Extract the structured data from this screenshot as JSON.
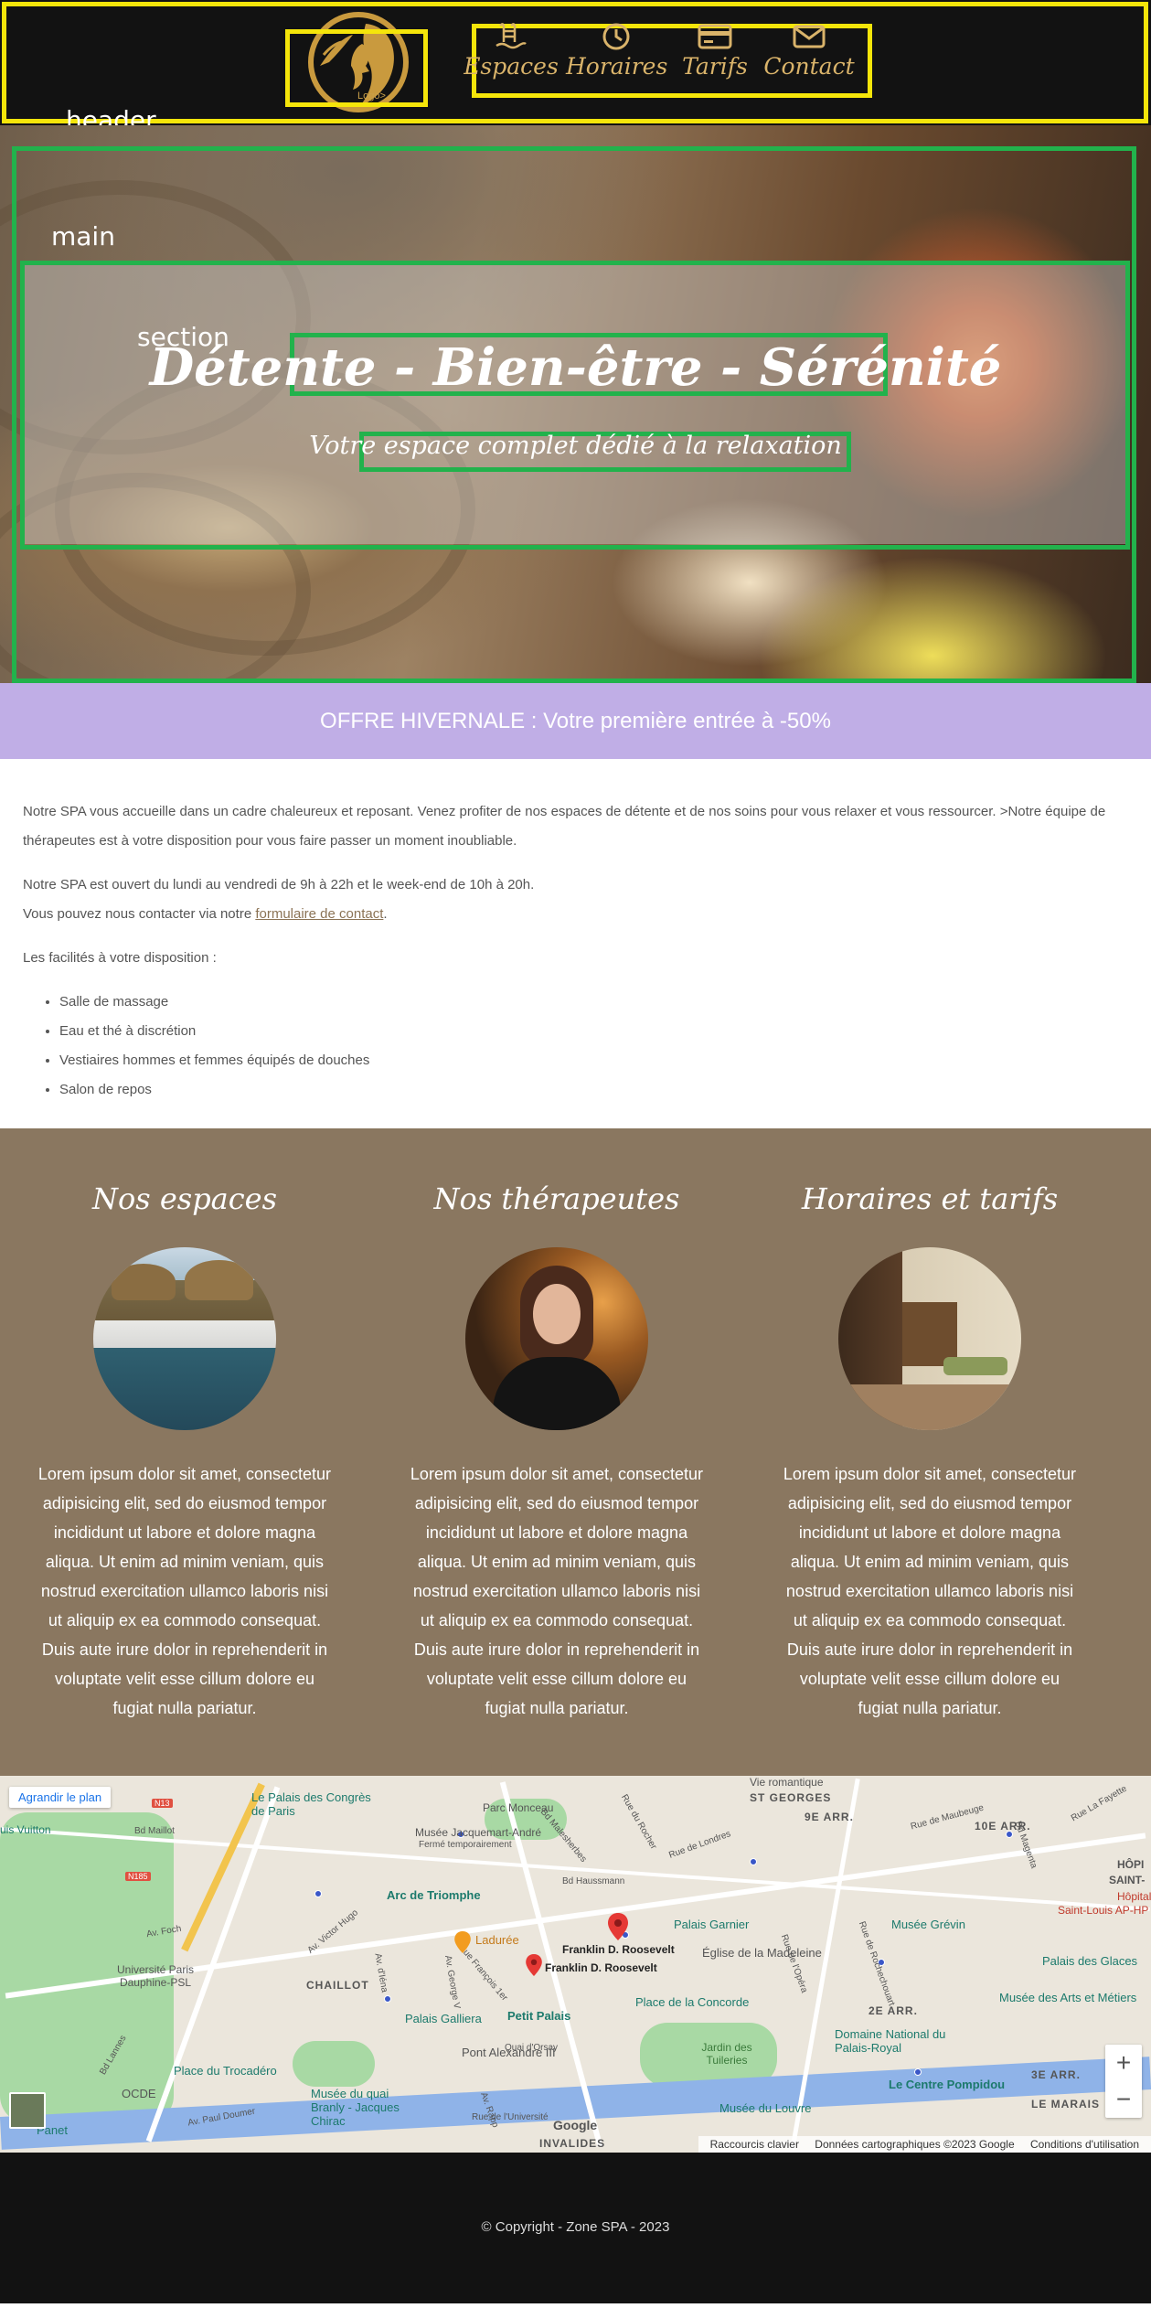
{
  "debug_labels": {
    "header": "header",
    "main": "main",
    "section": "section"
  },
  "header": {
    "logo_alt": "Logo>",
    "nav": [
      {
        "label": "Espaces",
        "icon": "pool-icon"
      },
      {
        "label": "Horaires",
        "icon": "clock-icon"
      },
      {
        "label": "Tarifs",
        "icon": "credit-card-icon"
      },
      {
        "label": "Contact",
        "icon": "envelope-icon"
      }
    ]
  },
  "hero": {
    "title": "Détente - Bien-être - Sérénité",
    "subtitle": "Votre espace complet dédié à la relaxation"
  },
  "offer": {
    "text": "OFFRE HIVERNALE : Votre première entrée à -50%"
  },
  "intro": {
    "p1": "Notre SPA vous accueille dans un cadre chaleureux et reposant. Venez profiter de nos espaces de détente et de nos soins pour vous relaxer et vous ressourcer. >Notre équipe de thérapeutes est à votre disposition pour vous faire passer un moment inoubliable.",
    "hours": "Notre SPA est ouvert du lundi au vendredi de 9h à 22h et le week-end de 10h à 20h.",
    "contact_prefix": "Vous pouvez nous contacter via notre ",
    "contact_link": "formulaire de contact",
    "contact_suffix": ".",
    "facilities_title": "Les facilités à votre disposition :",
    "facilities": [
      "Salle de massage",
      "Eau et thé à discrétion",
      "Vestiaires hommes et femmes équipés de douches",
      "Salon de repos"
    ]
  },
  "features": [
    {
      "title": "Nos espaces",
      "text": "Lorem ipsum dolor sit amet, consectetur adipisicing elit, sed do eiusmod tempor incididunt ut labore et dolore magna aliqua. Ut enim ad minim veniam, quis nostrud exercitation ullamco laboris nisi ut aliquip ex ea commodo consequat. Duis aute irure dolor in reprehenderit in voluptate velit esse cillum dolore eu fugiat nulla pariatur."
    },
    {
      "title": "Nos thérapeutes",
      "text": "Lorem ipsum dolor sit amet, consectetur adipisicing elit, sed do eiusmod tempor incididunt ut labore et dolore magna aliqua. Ut enim ad minim veniam, quis nostrud exercitation ullamco laboris nisi ut aliquip ex ea commodo consequat. Duis aute irure dolor in reprehenderit in voluptate velit esse cillum dolore eu fugiat nulla pariatur."
    },
    {
      "title": "Horaires et tarifs",
      "text": "Lorem ipsum dolor sit amet, consectetur adipisicing elit, sed do eiusmod tempor incididunt ut labore et dolore magna aliqua. Ut enim ad minim veniam, quis nostrud exercitation ullamco laboris nisi ut aliquip ex ea commodo consequat. Duis aute irure dolor in reprehenderit in voluptate velit esse cillum dolore eu fugiat nulla pariatur."
    }
  ],
  "map": {
    "enlarge": "Agrandir le plan",
    "labels": [
      "ST GEORGES",
      "9E ARR.",
      "10E ARR.",
      "CHAILLOT",
      "2E ARR.",
      "3E ARR.",
      "LE MARAIS",
      "INVALIDES",
      "Parc Monceau",
      "Bd Haussmann",
      "Bd Malesherbes",
      "Rue de Londres",
      "Av. Foch",
      "Av. Victor Hugo",
      "Bd Lannes",
      "Quai d'Orsay",
      "Rue de l'Université",
      "Av. Paul Doumer",
      "Musée Jacquemart-André",
      "Fermé temporairement",
      "Université Paris Dauphine-PSL",
      "Franklin D. Roosevelt",
      "Franklin D. Roosevelt",
      "Jardin des Tuileries",
      "Saint-Louis AP-HP",
      "Hôpital",
      "SAINT-",
      "HÔPI",
      "uis Vuitton",
      "Rue de Maubeuge",
      "Rue La Fayette",
      "Bd Magenta",
      "Rue du Rocher",
      "Rue de Rochechouart",
      "Vie romantique",
      "N13",
      "N185",
      "Av. George V",
      "Rue François 1er",
      "Av. d'Iéna",
      "Av. Rapp",
      "Rue de l'Opéra",
      "Bd Maillot"
    ],
    "pois": [
      "Le Palais des Congrès de Paris",
      "Arc de Triomphe",
      "Ladurée",
      "Palais Garnier",
      "Musée Grévin",
      "Église de la Madeleine",
      "Place de la Concorde",
      "Palais Galliera",
      "Petit Palais",
      "Pont Alexandre III",
      "Place du Trocadéro",
      "Musée du quai Branly - Jacques Chirac",
      "Domaine National du Palais-Royal",
      "Le Centre Pompidou",
      "Musée du Louvre",
      "Musée des Arts et Métiers",
      "Palais des Glaces",
      "OCDE",
      "Panet"
    ],
    "footer": [
      "Raccourcis clavier",
      "Données cartographiques ©2023 Google",
      "Conditions d'utilisation"
    ],
    "google": "Google",
    "zoom_in": "+",
    "zoom_out": "−"
  },
  "footer": {
    "copyright": "© Copyright - Zone SPA - 2023"
  },
  "colors": {
    "header_bg": "#121212",
    "gold": "#d9b36a",
    "offer_bg": "#c0aee6",
    "features_bg": "#8a7760",
    "debug_yellow": "#f5e50a",
    "debug_green": "#22b24c"
  }
}
